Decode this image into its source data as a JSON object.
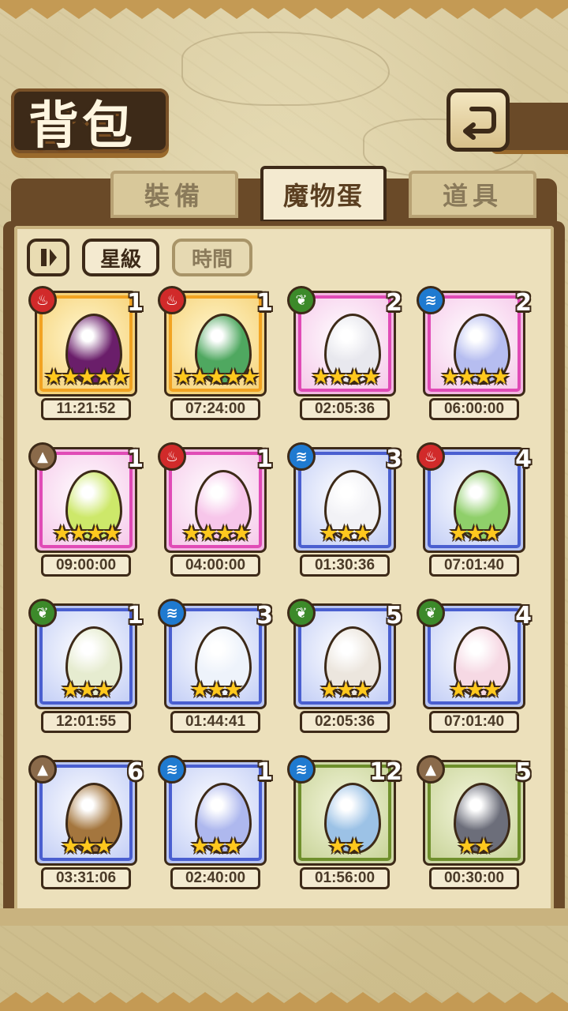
{
  "header": {
    "title": "背包"
  },
  "tabs": [
    {
      "label": "裝備",
      "active": false
    },
    {
      "label": "魔物蛋",
      "active": true
    },
    {
      "label": "道具",
      "active": false
    }
  ],
  "sort": {
    "star_label": "星級",
    "time_label": "時間",
    "active": "star"
  },
  "colors": {
    "fire": "#d12a2a",
    "leaf": "#3c8a2a",
    "water": "#1f7ad0",
    "earth": "#8a6a4a"
  },
  "eggs": [
    {
      "element": "fire",
      "count": "1",
      "stars": "★★★★★",
      "timer": "11:21:52",
      "rarity": "gold",
      "egg_color": "#6a1e6a"
    },
    {
      "element": "fire",
      "count": "1",
      "stars": "★★★★★",
      "timer": "07:24:00",
      "rarity": "gold",
      "egg_color": "#4fa860"
    },
    {
      "element": "leaf",
      "count": "2",
      "stars": "★★★★",
      "timer": "02:05:36",
      "rarity": "pink",
      "egg_color": "#e8e8ee"
    },
    {
      "element": "water",
      "count": "2",
      "stars": "★★★★",
      "timer": "06:00:00",
      "rarity": "pink",
      "egg_color": "#b6bdf0"
    },
    {
      "element": "earth",
      "count": "1",
      "stars": "★★★★",
      "timer": "09:00:00",
      "rarity": "pink",
      "egg_color": "#cde86a"
    },
    {
      "element": "fire",
      "count": "1",
      "stars": "★★★★",
      "timer": "04:00:00",
      "rarity": "pink",
      "egg_color": "#f7c6ea"
    },
    {
      "element": "water",
      "count": "3",
      "stars": "★★★",
      "timer": "01:30:36",
      "rarity": "blue",
      "egg_color": "#f2f2f6"
    },
    {
      "element": "fire",
      "count": "4",
      "stars": "★★★",
      "timer": "07:01:40",
      "rarity": "blue",
      "egg_color": "#8fcf6a"
    },
    {
      "element": "leaf",
      "count": "1",
      "stars": "★★★",
      "timer": "12:01:55",
      "rarity": "blue",
      "egg_color": "#e6ecd0"
    },
    {
      "element": "water",
      "count": "3",
      "stars": "★★★",
      "timer": "01:44:41",
      "rarity": "blue",
      "egg_color": "#eef3fb"
    },
    {
      "element": "leaf",
      "count": "5",
      "stars": "★★★",
      "timer": "02:05:36",
      "rarity": "blue",
      "egg_color": "#ece6de"
    },
    {
      "element": "leaf",
      "count": "4",
      "stars": "★★★",
      "timer": "07:01:40",
      "rarity": "blue",
      "egg_color": "#f6d9e4"
    },
    {
      "element": "earth",
      "count": "6",
      "stars": "★★★",
      "timer": "03:31:06",
      "rarity": "blue",
      "egg_color": "#a4763e"
    },
    {
      "element": "water",
      "count": "1",
      "stars": "★★★",
      "timer": "02:40:00",
      "rarity": "blue",
      "egg_color": "#aeb8ee"
    },
    {
      "element": "water",
      "count": "12",
      "stars": "★★",
      "timer": "01:56:00",
      "rarity": "green",
      "egg_color": "#9cc2e6"
    },
    {
      "element": "earth",
      "count": "5",
      "stars": "★★",
      "timer": "00:30:00",
      "rarity": "green",
      "egg_color": "#6c6e7a"
    }
  ]
}
